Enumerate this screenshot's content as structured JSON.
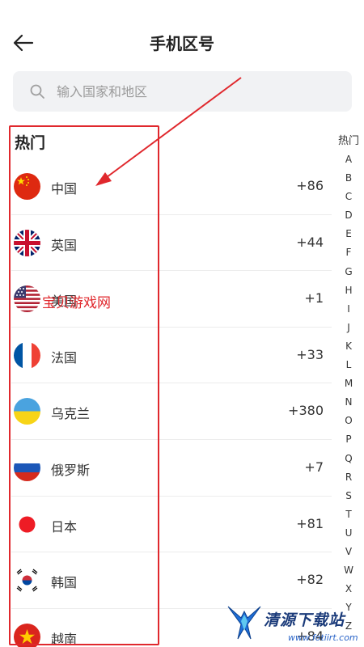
{
  "header": {
    "title": "手机区号"
  },
  "search": {
    "placeholder": "输入国家和地区"
  },
  "section": {
    "title": "热门"
  },
  "countries": [
    {
      "name": "中国",
      "code": "+86",
      "flag": "china-flag-icon"
    },
    {
      "name": "英国",
      "code": "+44",
      "flag": "uk-flag-icon"
    },
    {
      "name": "美国",
      "code": "+1",
      "flag": "usa-flag-icon"
    },
    {
      "name": "法国",
      "code": "+33",
      "flag": "france-flag-icon"
    },
    {
      "name": "乌克兰",
      "code": "+380",
      "flag": "ukraine-flag-icon"
    },
    {
      "name": "俄罗斯",
      "code": "+7",
      "flag": "russia-flag-icon"
    },
    {
      "name": "日本",
      "code": "+81",
      "flag": "japan-flag-icon"
    },
    {
      "name": "韩国",
      "code": "+82",
      "flag": "korea-flag-icon"
    },
    {
      "name": "越南",
      "code": "+84",
      "flag": "vietnam-flag-icon"
    }
  ],
  "index": {
    "hot": "热门",
    "letters": [
      "A",
      "B",
      "C",
      "D",
      "E",
      "F",
      "G",
      "H",
      "I",
      "J",
      "K",
      "L",
      "M",
      "N",
      "O",
      "P",
      "Q",
      "R",
      "S",
      "T",
      "U",
      "V",
      "W",
      "X",
      "Y",
      "Z"
    ]
  },
  "annotation": {
    "overlay_text": "宝贝游戏网",
    "color": "#e0282d"
  },
  "watermark": {
    "main": "清源下载站",
    "url": "www.fotiirt.com"
  }
}
